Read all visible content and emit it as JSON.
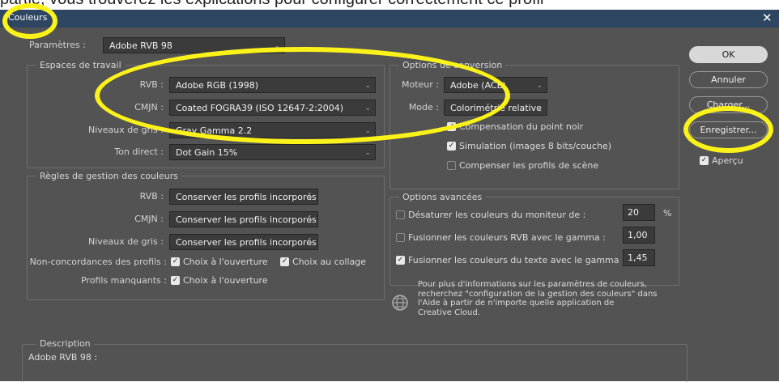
{
  "background_text": "partie, vous trouverez les explications pour configurer correctement ce profil",
  "window": {
    "title": "Couleurs",
    "close_glyph": "✕"
  },
  "parametres": {
    "label": "Paramètres :",
    "value": "Adobe RVB 98"
  },
  "espaces": {
    "legend": "Espaces de travail",
    "rows": [
      {
        "label": "RVB :",
        "value": "Adobe RGB (1998)"
      },
      {
        "label": "CMJN :",
        "value": "Coated FOGRA39 (ISO 12647-2:2004)"
      },
      {
        "label": "Niveaux de gris :",
        "value": "Gray Gamma 2.2"
      },
      {
        "label": "Ton direct :",
        "value": "Dot Gain 15%"
      }
    ]
  },
  "regles": {
    "legend": "Règles de gestion des couleurs",
    "rows": [
      {
        "label": "RVB :",
        "value": "Conserver les profils incorporés"
      },
      {
        "label": "CMJN :",
        "value": "Conserver les profils incorporés"
      },
      {
        "label": "Niveaux de gris :",
        "value": "Conserver les profils incorporés"
      }
    ],
    "non_concordances": {
      "label": "Non-concordances des profils :",
      "choix_ouverture": "Choix à l'ouverture",
      "choix_collage": "Choix au collage"
    },
    "profils_manquants": {
      "label": "Profils manquants :",
      "choix_ouverture": "Choix à l'ouverture"
    }
  },
  "options_conversion": {
    "legend": "Options de conversion",
    "moteur": {
      "label": "Moteur :",
      "value": "Adobe (ACE)"
    },
    "mode": {
      "label": "Mode :",
      "value": "Colorimétrie relative"
    },
    "checks": [
      {
        "label": "Compensation du point noir",
        "checked": true
      },
      {
        "label": "Simulation (images 8 bits/couche)",
        "checked": true
      },
      {
        "label": "Compenser les profils de scène",
        "checked": false
      }
    ]
  },
  "options_avancees": {
    "legend": "Options avancées",
    "rows": [
      {
        "label": "Désaturer les couleurs du moniteur de :",
        "checked": false,
        "value": "20",
        "unit": "%"
      },
      {
        "label": "Fusionner les couleurs RVB avec le gamma :",
        "checked": false,
        "value": "1,00"
      },
      {
        "label": "Fusionner les couleurs du texte avec le gamma :",
        "checked": true,
        "value": "1,45"
      }
    ]
  },
  "info": {
    "icon": "globe-icon",
    "lines": [
      "Pour plus d'informations sur les paramètres de couleurs,",
      "recherchez \"configuration de la gestion des couleurs\" dans",
      "l'Aide à partir de n'importe quelle application de",
      "Creative Cloud."
    ]
  },
  "description": {
    "legend": "Description",
    "text": "Adobe RVB 98 :"
  },
  "buttons": {
    "ok": "OK",
    "annuler": "Annuler",
    "charger": "Charger...",
    "enregistrer": "Enregistrer..."
  },
  "apercu": {
    "label": "Aperçu",
    "checked": true
  },
  "check_glyph": "✓",
  "chev_glyph": "⌄",
  "colors": {
    "annotation": "#fbf21a",
    "dialog_bg": "#535353",
    "titlebar": "#2f4662"
  }
}
